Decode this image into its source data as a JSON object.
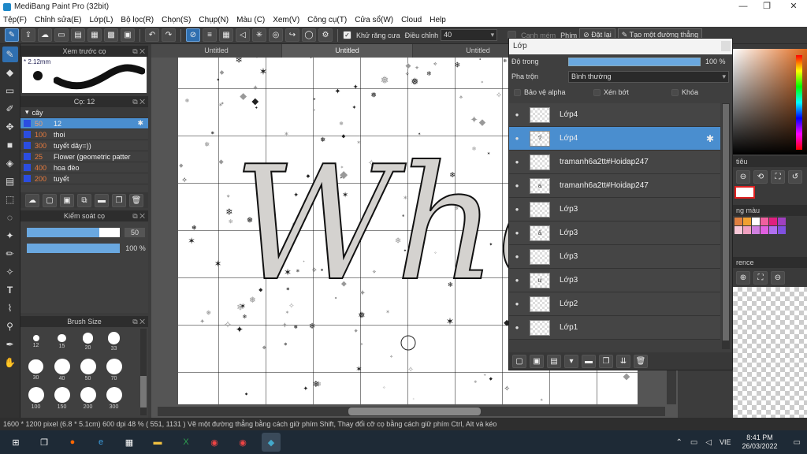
{
  "window": {
    "title": "MediBang Paint Pro (32bit)"
  },
  "menu": [
    "Tệp(F)",
    "Chỉnh sửa(E)",
    "Lớp(L)",
    "Bộ lọc(R)",
    "Chọn(S)",
    "Chụp(N)",
    "Màu (C)",
    "Xem(V)",
    "Công cụ(T)",
    "Cửa sổ(W)",
    "Cloud",
    "Help"
  ],
  "toolbar": {
    "antialias_label": "Khử răng cưa",
    "adjust_label": "Điều chỉnh",
    "adjust_value": "40",
    "snap_label": "Canh mém",
    "key_label": "Phím",
    "reset_label": "Đặt lại",
    "line_label": "Tạo một đường thẳng"
  },
  "brush_preview": {
    "title": "Xem trước cọ",
    "size": "2.12mm"
  },
  "brush_list": {
    "title": "Cọ: 12",
    "group": "cây",
    "items": [
      {
        "size": "50",
        "name": "12",
        "selected": true
      },
      {
        "size": "100",
        "name": "thoi"
      },
      {
        "size": "300",
        "name": "tuyết dây=))"
      },
      {
        "size": "25",
        "name": "Flower (geometric patter"
      },
      {
        "size": "400",
        "name": "hoa đèo"
      },
      {
        "size": "200",
        "name": "tuyết"
      }
    ]
  },
  "brush_control": {
    "title": "Kiểm soát cọ",
    "size_value": "50",
    "opacity_value": "100 %",
    "size_fraction": 0.78,
    "opacity_fraction": 1.0
  },
  "brush_size": {
    "title": "Brush Size",
    "sizes": [
      "12",
      "15",
      "20",
      "33",
      "30",
      "40",
      "50",
      "70",
      "100",
      "150",
      "200",
      "300"
    ]
  },
  "doc_tabs": [
    "Untitled",
    "Untitled",
    "Untitled"
  ],
  "layers": {
    "title": "Lớp",
    "opacity_label": "Độ trong",
    "opacity_value": "100 %",
    "blend_label": "Pha trộn",
    "blend_value": "Bình thường",
    "protect_alpha": "Bảo vệ alpha",
    "clipping": "Xén bớt",
    "lock": "Khóa",
    "items": [
      {
        "name": "Lớp4",
        "thumb": ""
      },
      {
        "name": "Lớp4",
        "thumb": "?",
        "selected": true
      },
      {
        "name": "tramanh6a2tt#Hoidap247",
        "thumb": ""
      },
      {
        "name": "tramanh6a2tt#Hoidap247",
        "thumb": "a"
      },
      {
        "name": "Lớp3",
        "thumb": ""
      },
      {
        "name": "Lớp3",
        "thumb": "ả"
      },
      {
        "name": "Lớp3",
        "thumb": ""
      },
      {
        "name": "Lớp3",
        "thumb": "ư"
      },
      {
        "name": "Lớp2",
        "thumb": ""
      },
      {
        "name": "Lớp1",
        "thumb": ""
      }
    ]
  },
  "canvas": {
    "text": "Who?"
  },
  "right_panel": {
    "nav_label": "tiêu",
    "palette_label": "ng màu",
    "reference_label": "rence"
  },
  "status": {
    "text": "1600 * 1200 pixel   (6.8 * 5.1cm)  600 dpi  48 %  ( 551, 1131 )  Vẽ một đường thẳng bằng cách giữ phím Shift, Thay đổi cỡ cọ bằng cách giữ phím Ctrl, Alt và kéo"
  },
  "taskbar": {
    "lang": "VIE",
    "time": "8:41 PM",
    "date": "26/03/2022"
  },
  "colors": {
    "accent": "#4a8ecf",
    "panel": "#404040",
    "brush_swatch": "#2b4de0"
  }
}
